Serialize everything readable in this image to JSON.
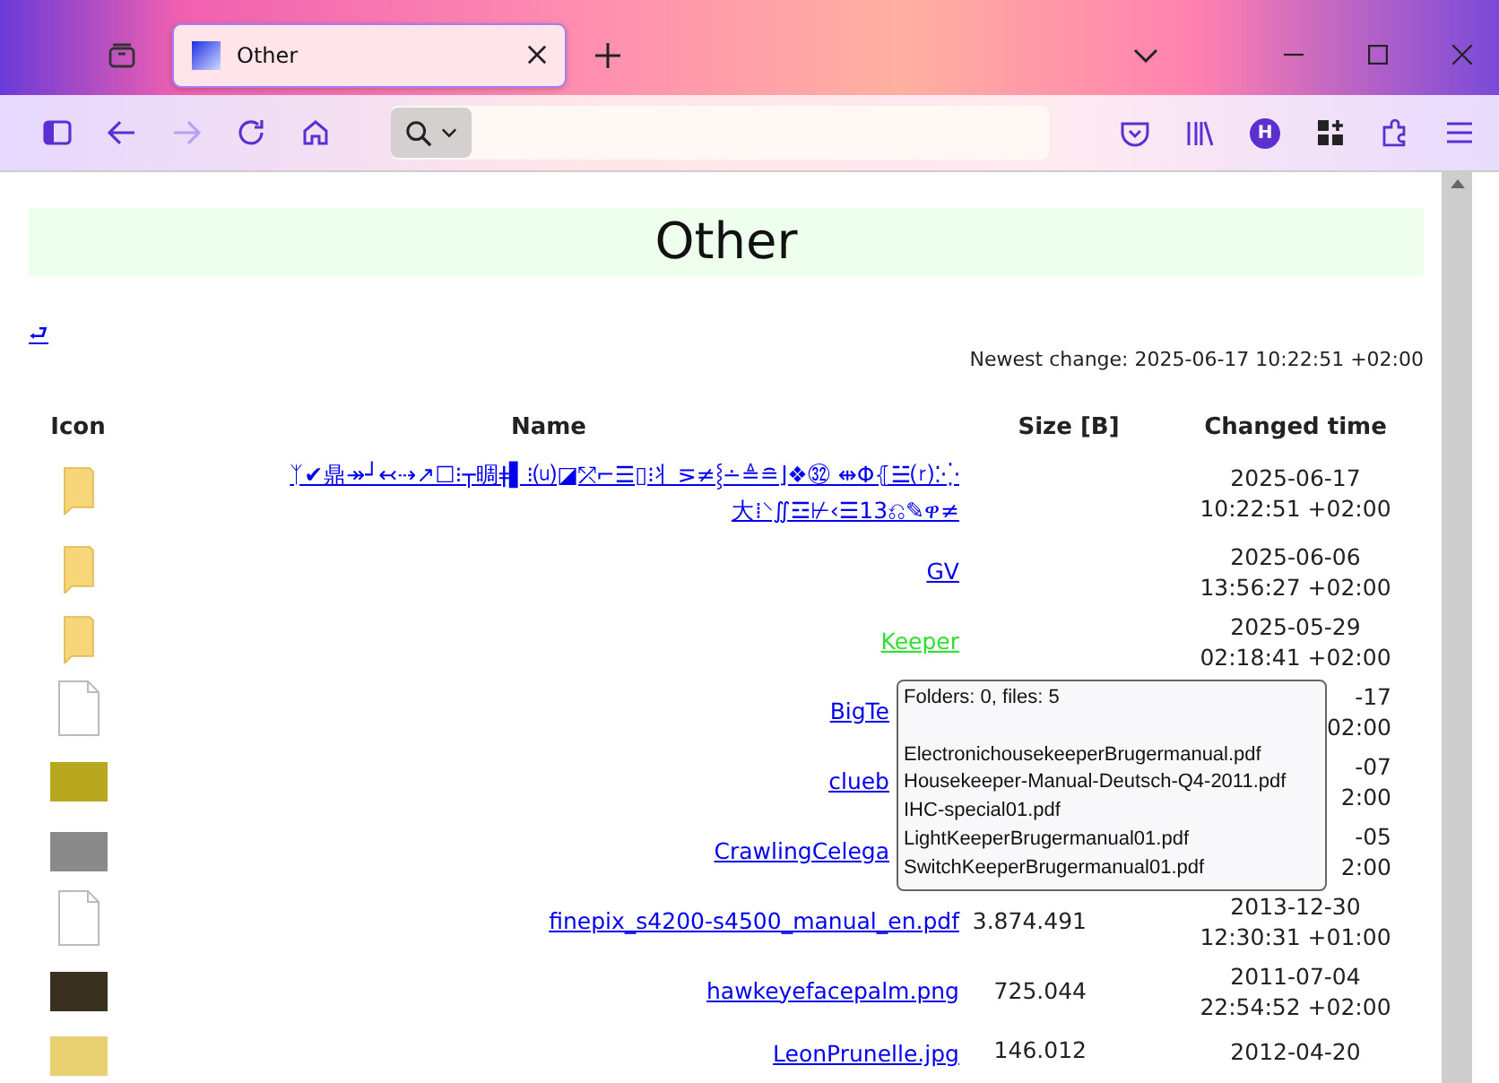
{
  "browser": {
    "tabs": [
      {
        "title": "Other",
        "selected": true
      }
    ],
    "forward_disabled": true,
    "account_initial": "H"
  },
  "page": {
    "heading": "Other",
    "parent_link": "⮐",
    "newest_change": "Newest change: 2025-06-17 10:22:51 +02:00",
    "table": {
      "columns": [
        "Icon",
        "Name",
        "Size [B]",
        "Changed time"
      ],
      "rows": [
        {
          "kind": "folder",
          "name": "ᛉ✔鼎↠┘↢⇢↗☐⁝┬晭ǂ▌⁝⒰◪⤱⌐☰▯⁝⺦⋝≠⸾∸≜≘⌋❖㉜ ⇹Φ⦃☱⒭⁚⁛大⁞⸌∬☲⊬‹☰13⎌✎ዋ≠",
          "size": "",
          "time": [
            "2025-06-17",
            "10:22:51 +02:00"
          ],
          "hovered": false,
          "covered": false
        },
        {
          "kind": "folder",
          "name": "GV",
          "size": "",
          "time": [
            "2025-06-06",
            "13:56:27 +02:00"
          ],
          "hovered": false,
          "covered": false
        },
        {
          "kind": "folder",
          "name": "Keeper",
          "size": "",
          "time": [
            "2025-05-29",
            "02:18:41 +02:00"
          ],
          "hovered": true,
          "covered": false
        },
        {
          "kind": "file",
          "name": "BigTe",
          "size": "",
          "time": [
            "-17",
            "02:00"
          ],
          "hovered": false,
          "covered": true
        },
        {
          "kind": "image",
          "color": "#b8a820",
          "name": "clueb",
          "size": "",
          "time": [
            "-07",
            "2:00"
          ],
          "hovered": false,
          "covered": true
        },
        {
          "kind": "image",
          "color": "#8a8a8a",
          "name": "CrawlingCelega",
          "size": "",
          "time": [
            "-05",
            "2:00"
          ],
          "hovered": false,
          "covered": true
        },
        {
          "kind": "file",
          "name": "finepix_s4200-s4500_manual_en.pdf",
          "size": "3.874.491",
          "time": [
            "2013-12-30",
            "12:30:31 +01:00"
          ],
          "hovered": false,
          "covered": false
        },
        {
          "kind": "image",
          "color": "#3a3020",
          "name": "hawkeyefacepalm.png",
          "size": "725.044",
          "time": [
            "2011-07-04",
            "22:54:52 +02:00"
          ],
          "hovered": false,
          "covered": false
        },
        {
          "kind": "image",
          "color": "#e8d070",
          "name": "LeonPrunelle.jpg",
          "size": "146.012",
          "time": [
            "2012-04-20"
          ],
          "hovered": false,
          "covered": false
        }
      ]
    },
    "tooltip": {
      "summary": "Folders: 0, files: 5",
      "files": [
        "ElectronichousekeeperBrugermanual.pdf",
        "Housekeeper-Manual-Deutsch-Q4-2011.pdf",
        "IHC-special01.pdf",
        "LightKeeperBrugermanual01.pdf",
        "SwitchKeeperBrugermanual01.pdf"
      ]
    }
  }
}
